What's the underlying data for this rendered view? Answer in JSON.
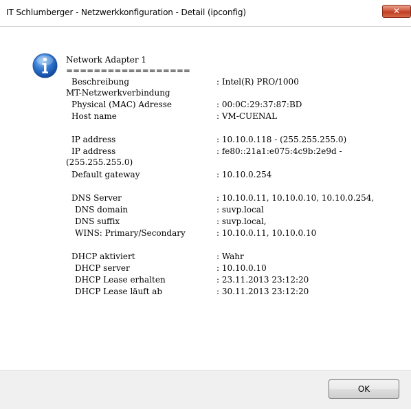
{
  "window": {
    "title": "IT Schlumberger - Netzwerkkonfiguration - Detail (ipconfig)",
    "close_glyph": "✕"
  },
  "icon": "info-icon",
  "colors": {
    "close_button": "#c9462a",
    "info_icon": "#2a6fc9"
  },
  "details": {
    "adapter_title": "Network Adapter 1",
    "separator": "==================",
    "rows": [
      {
        "label": "Beschreibung",
        "value": ": Intel(R) PRO/1000"
      },
      {
        "label": "MT-Netzwerkverbindung",
        "value": ""
      },
      {
        "label": "Physical (MAC) Adresse",
        "value": ": 00:0C:29:37:87:BD"
      },
      {
        "label": "Host name",
        "value": ": VM-CUENAL"
      },
      {
        "label": "IP address",
        "value": ": 10.10.0.118  -  (255.255.255.0)"
      },
      {
        "label": "IP address",
        "value": ": fe80::21a1:e075:4c9b:2e9d  -"
      },
      {
        "label": "(255.255.255.0)",
        "value": ""
      },
      {
        "label": "Default gateway",
        "value": ": 10.10.0.254"
      },
      {
        "label": "DNS Server",
        "value": ": 10.10.0.11, 10.10.0.10, 10.10.0.254,"
      },
      {
        "label": "DNS domain",
        "value": ": suvp.local"
      },
      {
        "label": "DNS suffix",
        "value": ": suvp.local,"
      },
      {
        "label": "WINS:  Primary/Secondary",
        "value": ": 10.10.0.11, 10.10.0.10"
      },
      {
        "label": "DHCP aktiviert",
        "value": ": Wahr"
      },
      {
        "label": "DHCP server",
        "value": ": 10.10.0.10"
      },
      {
        "label": "DHCP Lease erhalten",
        "value": ": 23.11.2013 23:12:20"
      },
      {
        "label": "DHCP Lease läuft ab",
        "value": ": 30.11.2013 23:12:20"
      }
    ]
  },
  "buttons": {
    "ok_label": "OK"
  }
}
